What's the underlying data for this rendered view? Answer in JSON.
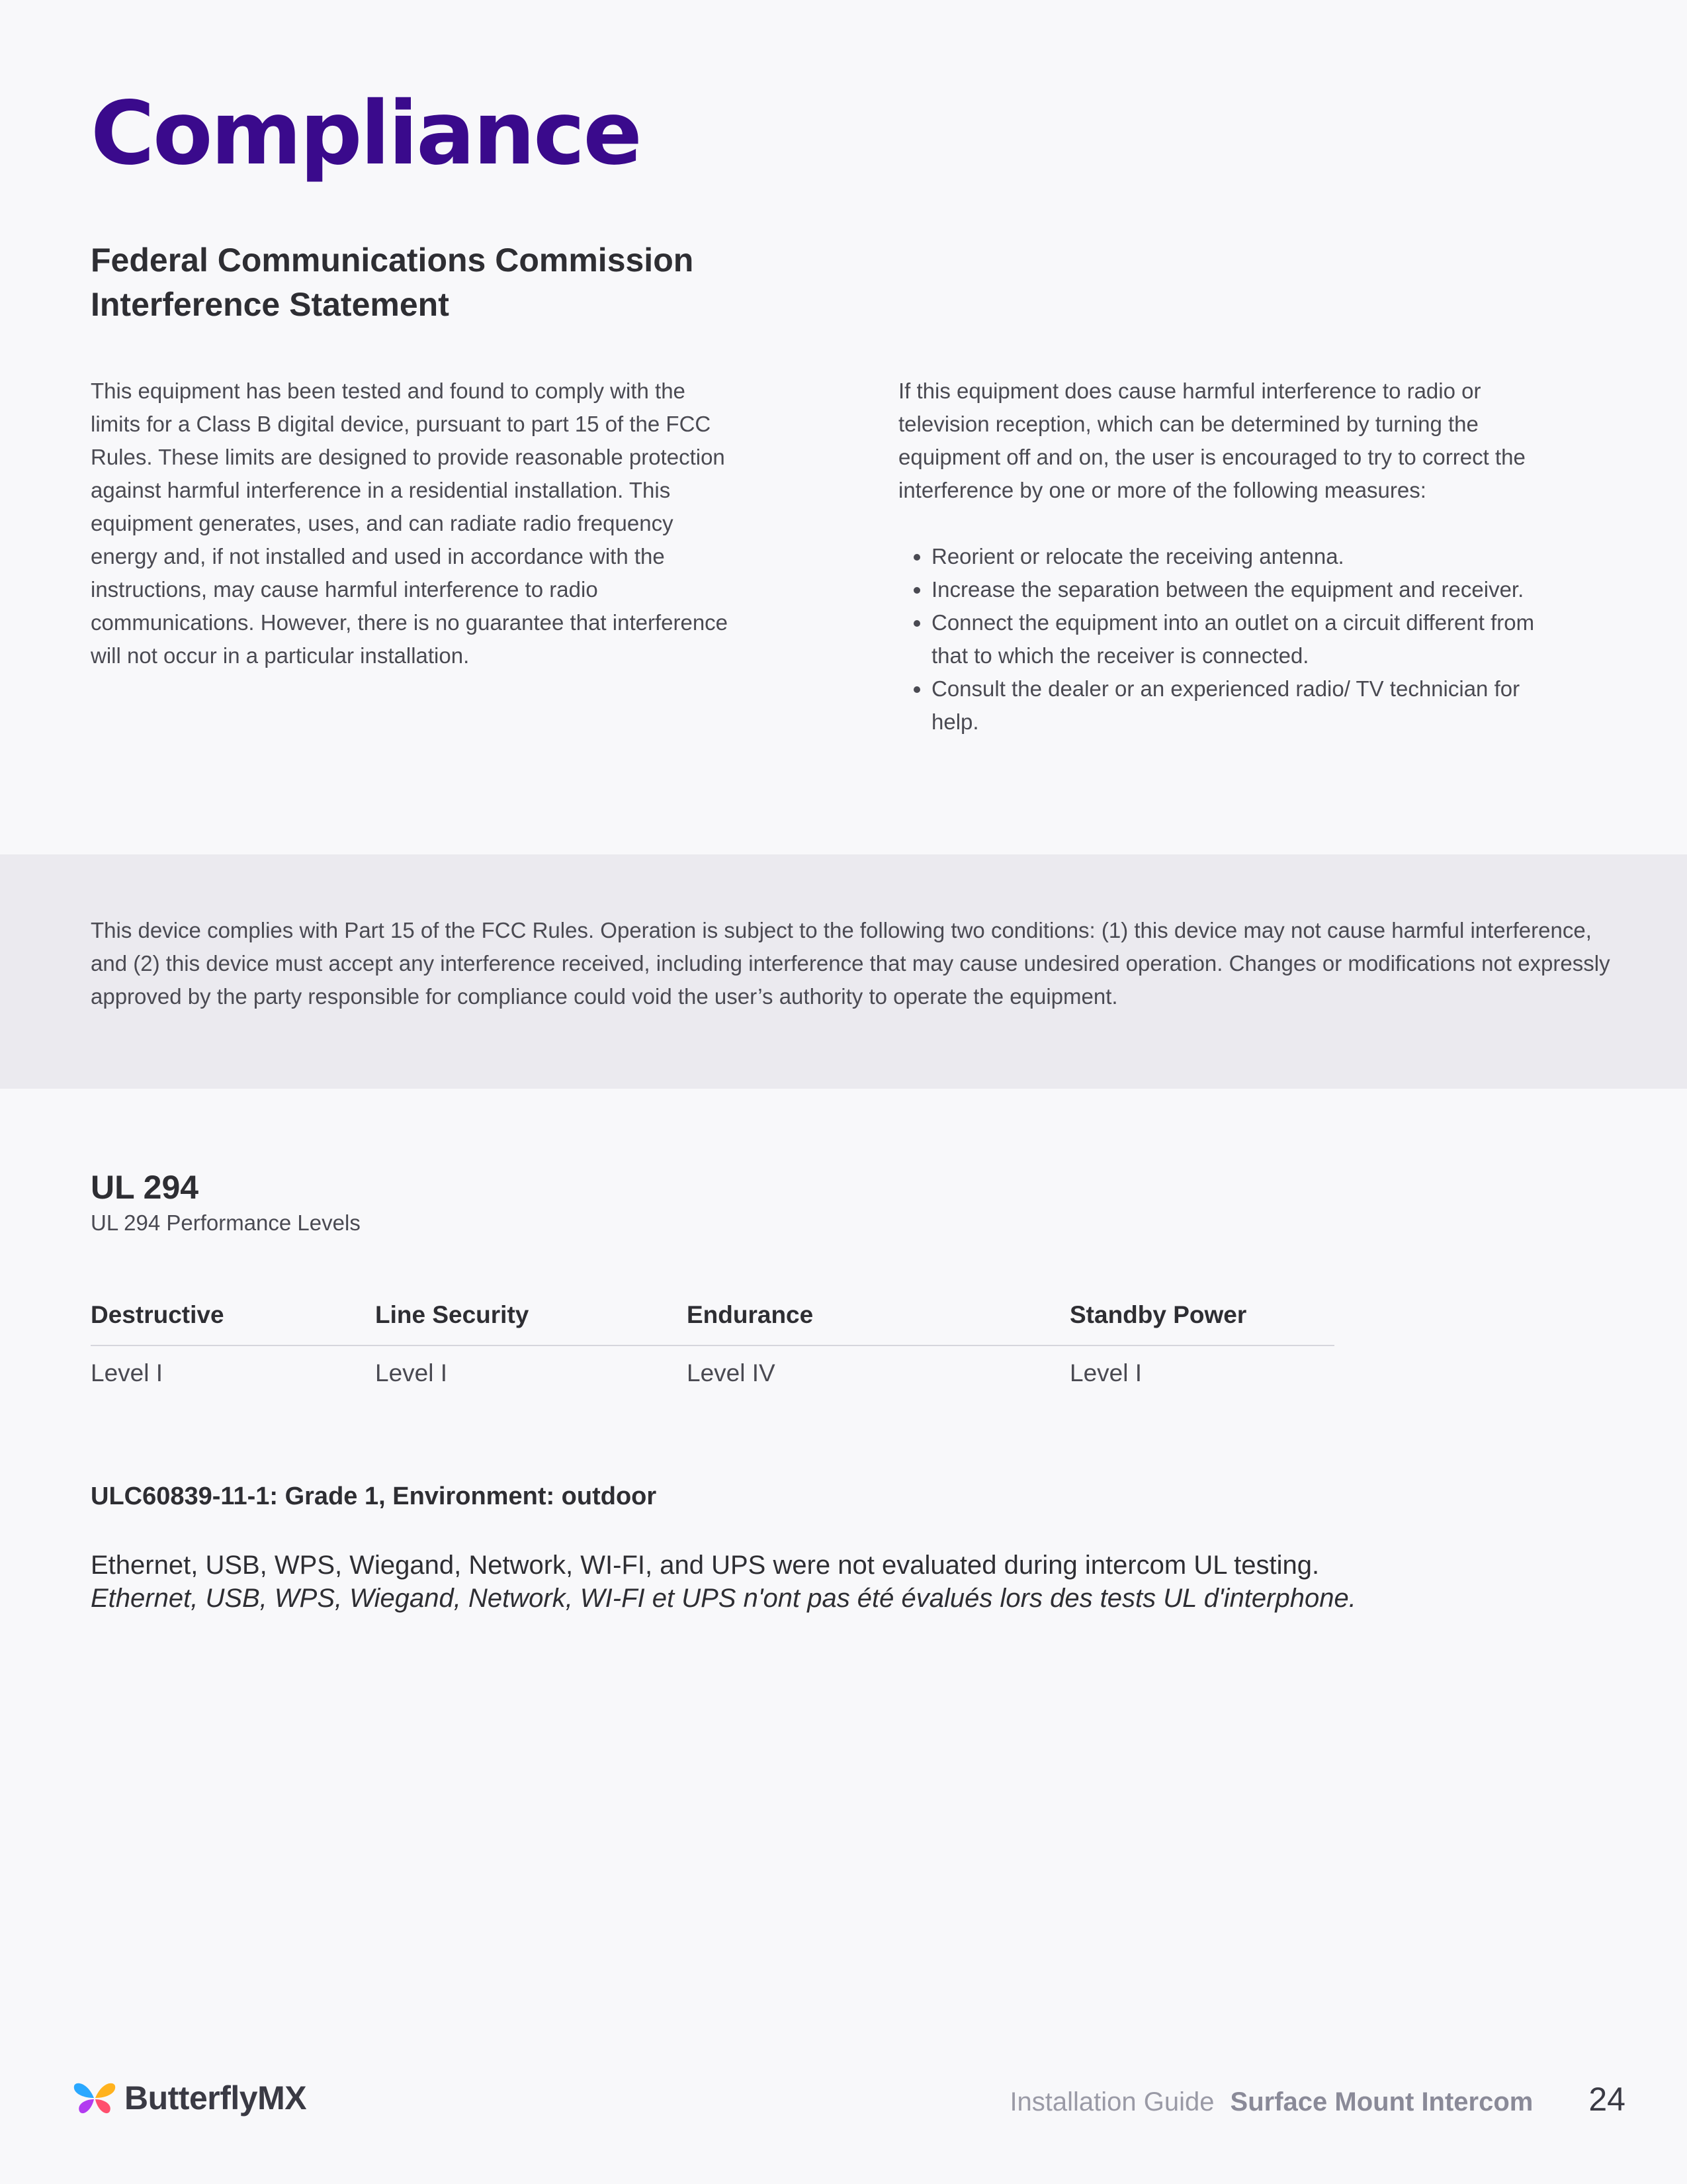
{
  "page": {
    "title": "Compliance"
  },
  "fcc": {
    "heading_line1": "Federal Communications Commission",
    "heading_line2": "Interference Statement",
    "left_paragraph": "This equipment has been tested and found to comply with the limits for a Class B digital device, pursuant to part 15 of the FCC Rules. These limits are designed to provide reasonable protection against harmful interference in a residential installation. This equipment generates, uses, and can radiate radio frequency energy and, if not installed and used in accordance with the instructions, may cause harmful interference to radio communications. However, there is no guarantee that interference will not occur in a particular installation.",
    "right_intro": "If this equipment does cause harmful interference to radio or television reception, which can be determined by turning the equipment off and on, the user is encouraged to try to correct the interference by one or more of the following measures:",
    "measures": [
      "Reorient or relocate the receiving antenna.",
      "Increase the separation between the equipment and receiver.",
      "Connect the equipment into an outlet on a circuit different from that to which the receiver is connected.",
      "Consult the dealer or an experienced radio/ TV technician for help."
    ],
    "part15_notice": "This device complies with Part 15 of the FCC Rules. Operation is subject to the following two conditions: (1) this device may not cause harmful interference, and (2) this device must accept any interference received, including interference that may cause undesired operation. Changes or modifications not expressly approved by the party responsible for compliance could void the user’s authority to operate the equipment."
  },
  "ul294": {
    "heading": "UL 294",
    "subheading": "UL 294 Performance Levels",
    "columns": [
      "Destructive",
      "Line Security",
      "Endurance",
      "Standby Power"
    ],
    "values": [
      "Level I",
      "Level I",
      "Level IV",
      "Level I"
    ],
    "ulc_line": "ULC60839-11-1: Grade 1, Environment: outdoor",
    "eval_en": "Ethernet, USB, WPS, Wiegand, Network, WI-FI, and UPS were not evaluated during intercom UL testing.",
    "eval_fr": "Ethernet, USB, WPS, Wiegand, Network, WI-FI et UPS n'ont pas été évalués lors des tests UL d'interphone."
  },
  "footer": {
    "brand": "ButterflyMX",
    "logo_icon": "butterfly-icon",
    "guide_label": "Installation Guide",
    "product": "Surface Mount Intercom",
    "page_number": "24"
  },
  "colors": {
    "title": "#3a0a8c",
    "band": "#ebeaef",
    "background": "#f8f8fa"
  }
}
